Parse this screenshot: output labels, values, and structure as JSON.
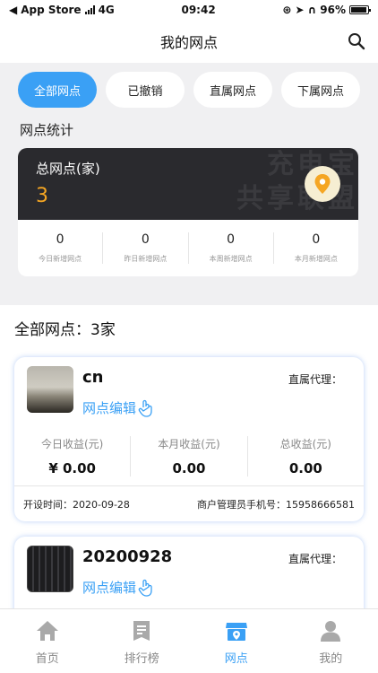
{
  "status_bar": {
    "carrier": "App Store",
    "network": "4G",
    "time": "09:42",
    "battery": "96%",
    "battery_level": 0.96
  },
  "nav": {
    "title": "我的网点"
  },
  "filter_tabs": [
    {
      "label": "全部网点",
      "active": true
    },
    {
      "label": "已撤销",
      "active": false
    },
    {
      "label": "直属网点",
      "active": false
    },
    {
      "label": "下属网点",
      "active": false
    }
  ],
  "stats": {
    "section_title": "网点统计",
    "total_label": "总网点(家)",
    "total_value": "3",
    "watermark_line1": "充电宝",
    "watermark_line2": "共享联盟",
    "cells": [
      {
        "value": "0",
        "caption": "今日新增网点"
      },
      {
        "value": "0",
        "caption": "昨日新增网点"
      },
      {
        "value": "0",
        "caption": "本周新增网点"
      },
      {
        "value": "0",
        "caption": "本月新增网点"
      }
    ]
  },
  "list_title": "全部网点：3家",
  "outlets": [
    {
      "name": "cn",
      "agent_label": "直属代理：",
      "edit_label": "网点编辑",
      "earnings": [
        {
          "caption": "今日收益(元)",
          "value": "¥ 0.00"
        },
        {
          "caption": "本月收益(元)",
          "value": "0.00"
        },
        {
          "caption": "总收益(元)",
          "value": "0.00"
        }
      ],
      "open_time": "开设时间：2020-09-28",
      "manager_phone": "商户管理员手机号：15958666581"
    },
    {
      "name": "20200928",
      "agent_label": "直属代理：",
      "edit_label": "网点编辑"
    }
  ],
  "tab_bar": [
    {
      "label": "首页",
      "icon": "home-icon",
      "active": false
    },
    {
      "label": "排行榜",
      "icon": "ranking-icon",
      "active": false
    },
    {
      "label": "网点",
      "icon": "store-icon",
      "active": true
    },
    {
      "label": "我的",
      "icon": "user-icon",
      "active": false
    }
  ],
  "colors": {
    "accent": "#3aa0f5",
    "dark_card": "#2a2a2e",
    "highlight": "#f5a623"
  }
}
